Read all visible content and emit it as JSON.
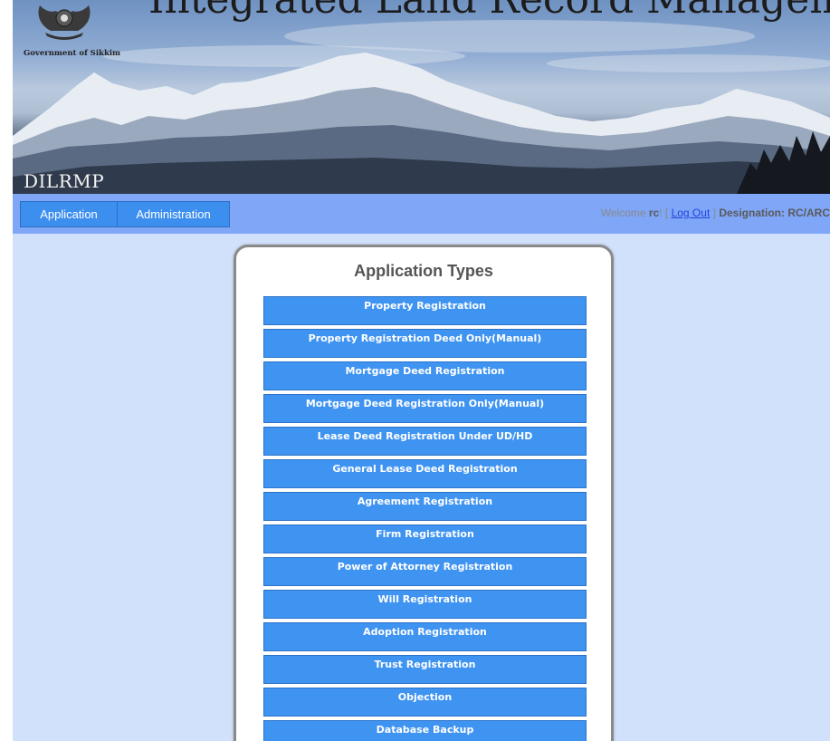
{
  "banner": {
    "title": "Integrated Land Record Management System",
    "government": "Government of Sikkim",
    "program": "DILRMP"
  },
  "nav": {
    "items": [
      {
        "label": "Application"
      },
      {
        "label": "Administration"
      }
    ]
  },
  "user": {
    "welcome_prefix": "Welcome",
    "username": "rc",
    "suffix": "!",
    "logout_open": "[",
    "logout": "Log Out",
    "logout_close": "]",
    "designation_label": "Designation:",
    "designation": "RC/ARC"
  },
  "panel": {
    "title": "Application Types",
    "buttons": [
      "Property Registration",
      "Property Registration Deed Only(Manual)",
      "Mortgage Deed Registration",
      "Mortgage Deed Registration Only(Manual)",
      "Lease Deed Registration Under UD/HD",
      "General Lease Deed Registration",
      "Agreement Registration",
      "Firm Registration",
      "Power of Attorney Registration",
      "Will Registration",
      "Adoption Registration",
      "Trust Registration",
      "Objection",
      "Database Backup"
    ]
  },
  "colors": {
    "page_background": "#d2e1fb",
    "navbar": "#7fa6f7",
    "button": "#3f93f1",
    "link": "#2244dd"
  }
}
